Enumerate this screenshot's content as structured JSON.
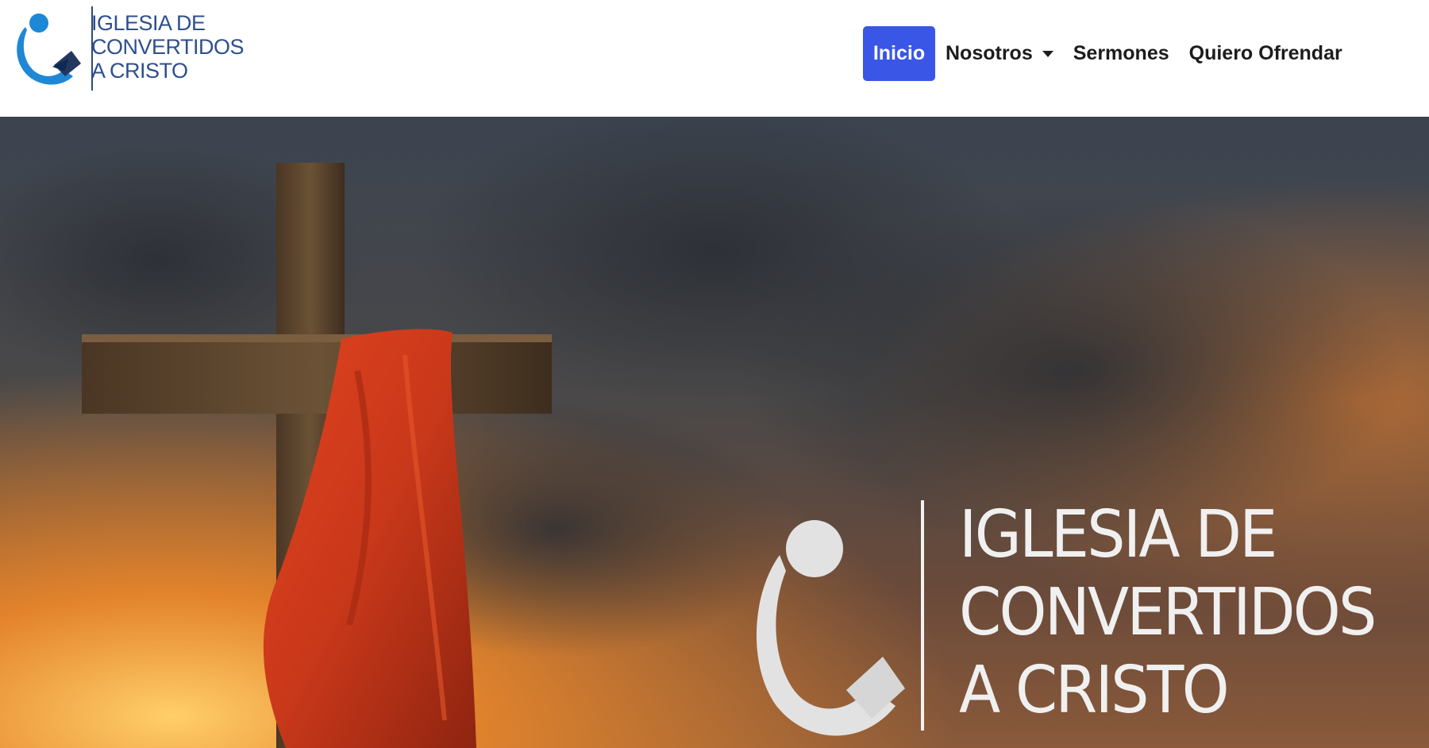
{
  "brand": {
    "lines": [
      "IGLESIA DE",
      "CONVERTIDOS",
      "A CRISTO"
    ],
    "logo_icon": "church-logo-icon",
    "colors": {
      "logo_blue": "#1e88d6",
      "text_navy": "#2e4f8f"
    }
  },
  "nav": {
    "items": [
      {
        "label": "Inicio",
        "active": true
      },
      {
        "label": "Nosotros",
        "has_dropdown": true
      },
      {
        "label": "Sermones"
      },
      {
        "label": "Quiero Ofrendar"
      }
    ],
    "active_color": "#3a56e6"
  },
  "hero": {
    "image": "cross-with-red-cloth-sunset-sky",
    "title_lines": [
      "IGLESIA DE",
      "CONVERTIDOS",
      "A CRISTO"
    ]
  }
}
